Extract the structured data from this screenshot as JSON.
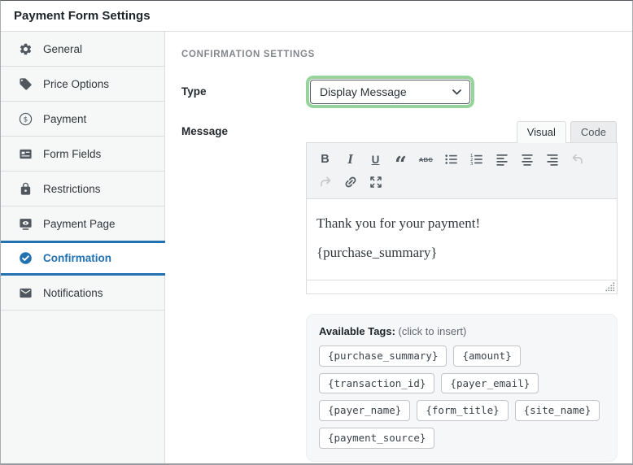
{
  "window": {
    "title": "Payment Form Settings"
  },
  "sidebar": {
    "items": [
      {
        "label": "General",
        "icon": "gear-icon",
        "active": false
      },
      {
        "label": "Price Options",
        "icon": "tag-icon",
        "active": false
      },
      {
        "label": "Payment",
        "icon": "dollar-circle-icon",
        "active": false
      },
      {
        "label": "Form Fields",
        "icon": "form-fields-icon",
        "active": false
      },
      {
        "label": "Restrictions",
        "icon": "lock-icon",
        "active": false
      },
      {
        "label": "Payment Page",
        "icon": "payment-page-icon",
        "active": false
      },
      {
        "label": "Confirmation",
        "icon": "check-circle-icon",
        "active": true
      },
      {
        "label": "Notifications",
        "icon": "envelope-icon",
        "active": false
      }
    ]
  },
  "main": {
    "section_heading": "CONFIRMATION SETTINGS",
    "type_field": {
      "label": "Type",
      "value": "Display Message"
    },
    "message_field": {
      "label": "Message"
    },
    "editor": {
      "tabs": [
        {
          "label": "Visual",
          "active": true
        },
        {
          "label": "Code",
          "active": false
        }
      ],
      "toolbar": {
        "bold_label": "B",
        "italic_label": "I",
        "underline_label": "U",
        "blockquote_glyph": "“",
        "strikethrough_label": "ABC"
      },
      "content": [
        "Thank you for your payment!",
        "{purchase_summary}"
      ]
    },
    "available_tags": {
      "label": "Available Tags:",
      "hint": "(click to insert)",
      "tags": [
        "{purchase_summary}",
        "{amount}",
        "{transaction_id}",
        "{payer_email}",
        "{payer_name}",
        "{form_title}",
        "{site_name}",
        "{payment_source}"
      ]
    }
  },
  "colors": {
    "accent_blue": "#2271b1",
    "focus_ring_green": "#97d49c",
    "icon_gray": "#50575e"
  }
}
